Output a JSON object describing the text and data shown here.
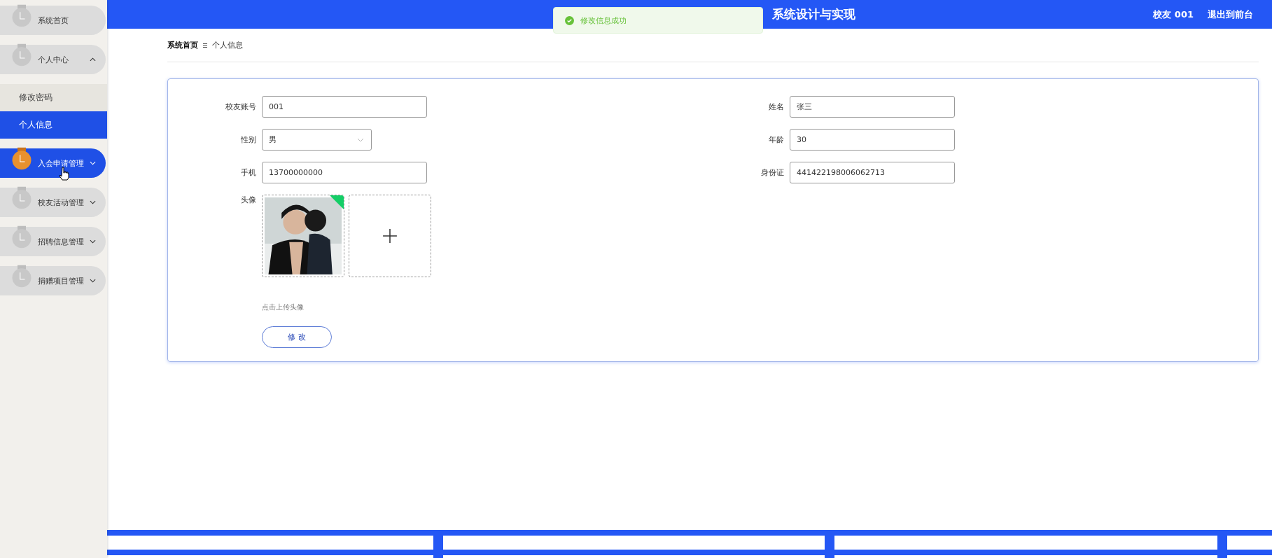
{
  "header": {
    "title": "系统设计与实现",
    "user": "校友 001",
    "exit": "退出到前台"
  },
  "toast": {
    "message": "修改信息成功"
  },
  "sidebar": {
    "items": [
      {
        "label": "系统首页",
        "kind": "link",
        "hovered": false
      },
      {
        "label": "个人中心",
        "kind": "group",
        "expanded": true,
        "hovered": false,
        "children": [
          {
            "label": "修改密码",
            "selected": false
          },
          {
            "label": "个人信息",
            "selected": true
          }
        ]
      },
      {
        "label": "入会申请管理",
        "kind": "group",
        "expanded": false,
        "hovered": true
      },
      {
        "label": "校友活动管理",
        "kind": "group",
        "expanded": false,
        "hovered": false
      },
      {
        "label": "招聘信息管理",
        "kind": "group",
        "expanded": false,
        "hovered": false
      },
      {
        "label": "捐赠项目管理",
        "kind": "group",
        "expanded": false,
        "hovered": false
      }
    ]
  },
  "breadcrumb": [
    "系统首页",
    "个人信息"
  ],
  "form": {
    "left": [
      {
        "label": "校友账号",
        "kind": "text",
        "value": "001"
      },
      {
        "label": "性别",
        "kind": "select",
        "value": "男"
      },
      {
        "label": "手机",
        "kind": "text",
        "value": "13700000000"
      }
    ],
    "right": [
      {
        "label": "姓名",
        "kind": "text",
        "value": "张三"
      },
      {
        "label": "年龄",
        "kind": "text",
        "value": "30"
      },
      {
        "label": "身份证",
        "kind": "text",
        "value": "441422198006062713"
      }
    ],
    "avatar": {
      "label": "头像",
      "uploaded": true,
      "hint": "点击上传头像"
    },
    "submit": "修 改"
  }
}
